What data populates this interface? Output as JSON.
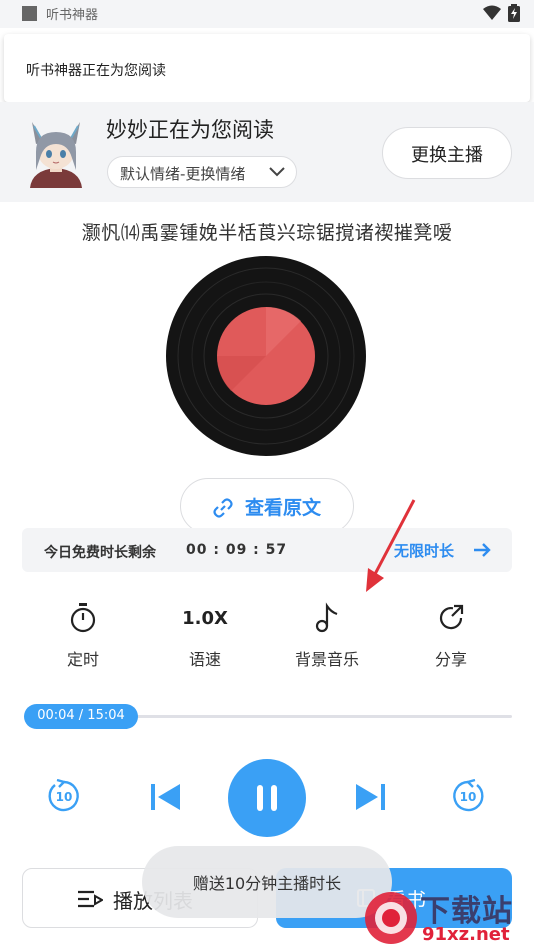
{
  "status_bar": {
    "app_title": "听书神器",
    "icons": [
      "wifi-icon",
      "battery-icon"
    ]
  },
  "notification": {
    "text": "听书神器正在为您阅读"
  },
  "anchor": {
    "name": "妙妙正在为您阅读",
    "emotion": "默认情绪-更换情绪",
    "change_button": "更换主播"
  },
  "book": {
    "title": "灏忛⒁禹霎锺娩半栝莨兴琮锯撹诸褉摧凳嗳"
  },
  "view_source": {
    "label": "查看原文",
    "icon": "link-icon"
  },
  "free_time": {
    "label": "今日免费时长剩余",
    "remaining": "00 : 09 : 57",
    "unlimited_label": "无限时长",
    "icon": "arrow-right-icon"
  },
  "features": [
    {
      "label": "定时",
      "icon": "timer-icon"
    },
    {
      "label": "语速",
      "value": "1.0X"
    },
    {
      "label": "背景音乐",
      "icon": "music-note-icon"
    },
    {
      "label": "分享",
      "icon": "share-icon"
    }
  ],
  "progress": {
    "current": "00:04",
    "total": "15:04",
    "display": "00:04 / 15:04"
  },
  "controls": {
    "rewind_seconds": "10",
    "forward_seconds": "10",
    "icons": [
      "rewind-10-icon",
      "previous-icon",
      "pause-icon",
      "next-icon",
      "forward-10-icon"
    ]
  },
  "bottom": {
    "playlist_label": "播放列表",
    "read_label": "看书"
  },
  "toast": {
    "text": "赠送10分钟主播时长"
  },
  "watermark": {
    "big": "下载站",
    "small": "91xz.net"
  },
  "colors": {
    "accent": "#3aa0f5",
    "link": "#2d8cf0",
    "vinyl_label": "#e05a5a",
    "annotation_arrow": "#e0323a"
  }
}
